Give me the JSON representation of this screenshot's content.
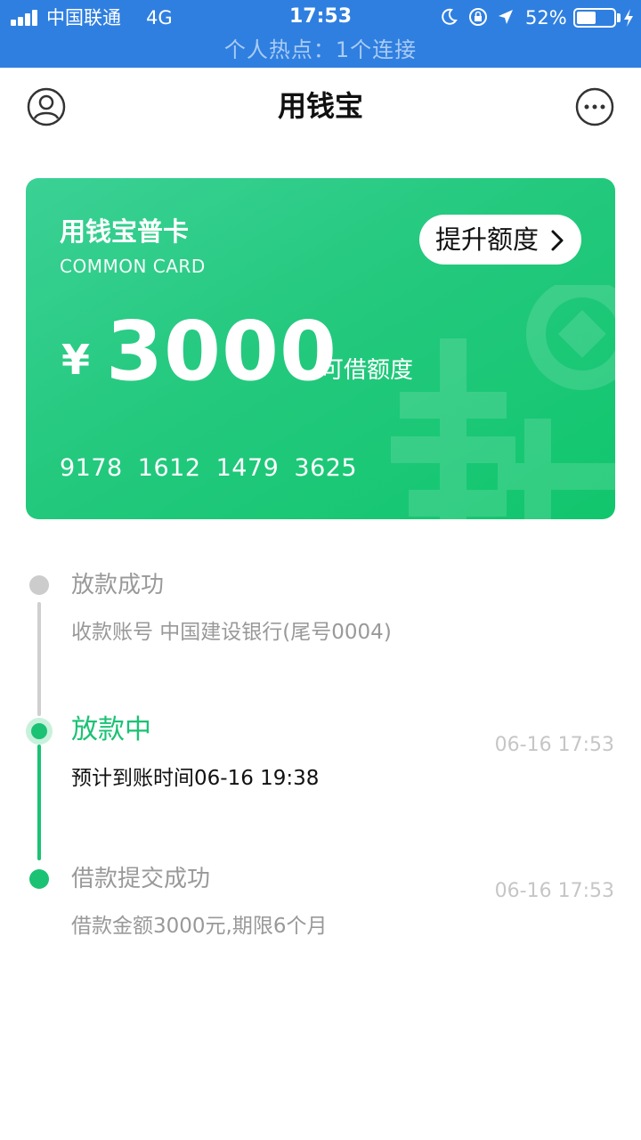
{
  "status_bar": {
    "carrier": "中国联通",
    "network": "4G",
    "time": "17:53",
    "battery_percent": "52%",
    "battery_level": 0.52,
    "hotspot_text": "个人热点：1个连接",
    "icons": [
      "signal-icon",
      "moon-icon",
      "orientation-lock-icon",
      "location-icon",
      "battery-icon",
      "charging-bolt-icon"
    ]
  },
  "nav": {
    "title": "用钱宝",
    "left_icon": "user-profile-icon",
    "right_icon": "more-options-icon"
  },
  "card": {
    "name": "用钱宝普卡",
    "subtitle": "COMMON CARD",
    "raise_button": "提升额度",
    "currency_symbol": "¥",
    "amount": "3000",
    "amount_label": "可借额度",
    "card_number": "9178 1612 1479 3625",
    "gradient_colors": [
      "#3bd196",
      "#11c66d"
    ]
  },
  "timeline": {
    "items": [
      {
        "title": "放款成功",
        "desc": "收款账号 中国建设银行(尾号0004)",
        "time": "",
        "state": "pending"
      },
      {
        "title": "放款中",
        "desc": "预计到账时间06-16 19:38",
        "time": "06-16 17:53",
        "state": "active"
      },
      {
        "title": "借款提交成功",
        "desc": "借款金额3000元,期限6个月",
        "time": "06-16 17:53",
        "state": "done"
      }
    ]
  },
  "colors": {
    "status_bar_bg": "#2f7fe0",
    "accent_green": "#1bc274",
    "muted_text": "#999999",
    "timestamp_text": "#c6c6c6"
  }
}
